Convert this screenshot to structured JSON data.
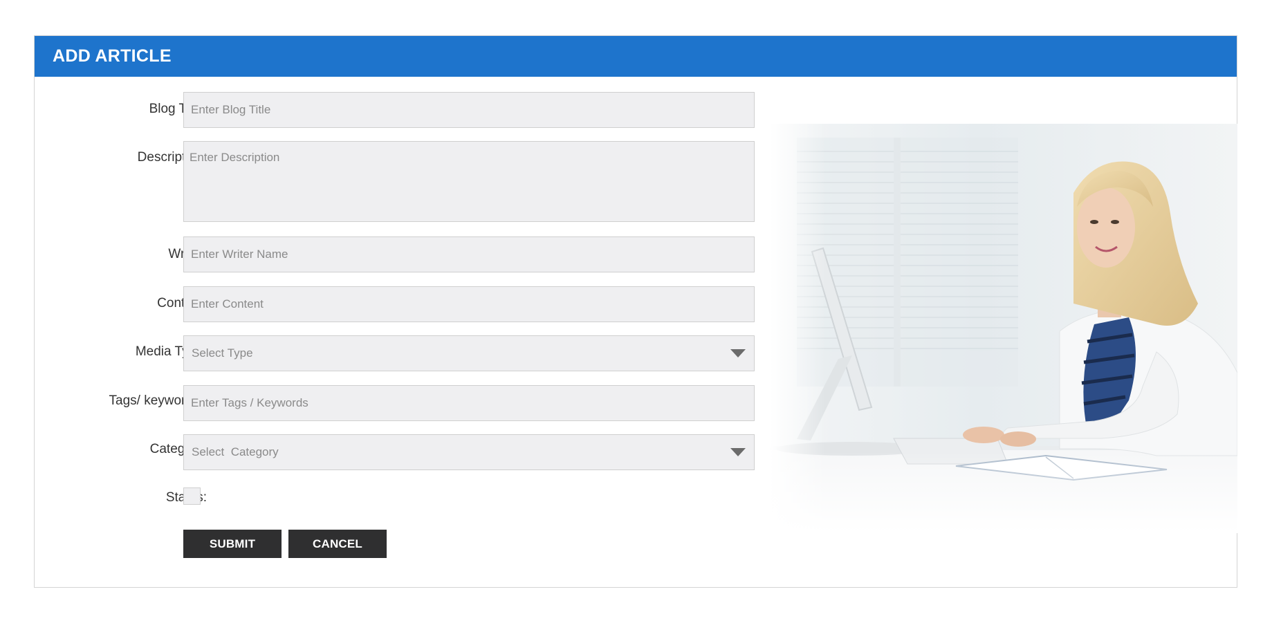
{
  "header": {
    "title": "ADD ARTICLE"
  },
  "form": {
    "blog_title": {
      "label": "Blog Title:",
      "placeholder": "Enter Blog Title"
    },
    "description": {
      "label": "Description:",
      "placeholder": "Enter Description"
    },
    "writer": {
      "label": "Writer:",
      "placeholder": "Enter Writer Name"
    },
    "content": {
      "label": "Content:",
      "placeholder": "Enter Content"
    },
    "media_type": {
      "label": "Media Type:",
      "selected": "Select Type"
    },
    "tags": {
      "label": "Tags/ keywords :",
      "placeholder": "Enter Tags / Keywords"
    },
    "category": {
      "label": "Category:",
      "selected": "Select  Category"
    },
    "status": {
      "label": "Status:",
      "checked": false
    }
  },
  "actions": {
    "submit_label": "SUBMIT",
    "cancel_label": "CANCEL"
  },
  "colors": {
    "header_bg": "#1e74cc",
    "button_bg": "#2f2f30",
    "field_bg": "#efeff1"
  },
  "icons": {
    "select_caret": "caret-down-icon"
  }
}
